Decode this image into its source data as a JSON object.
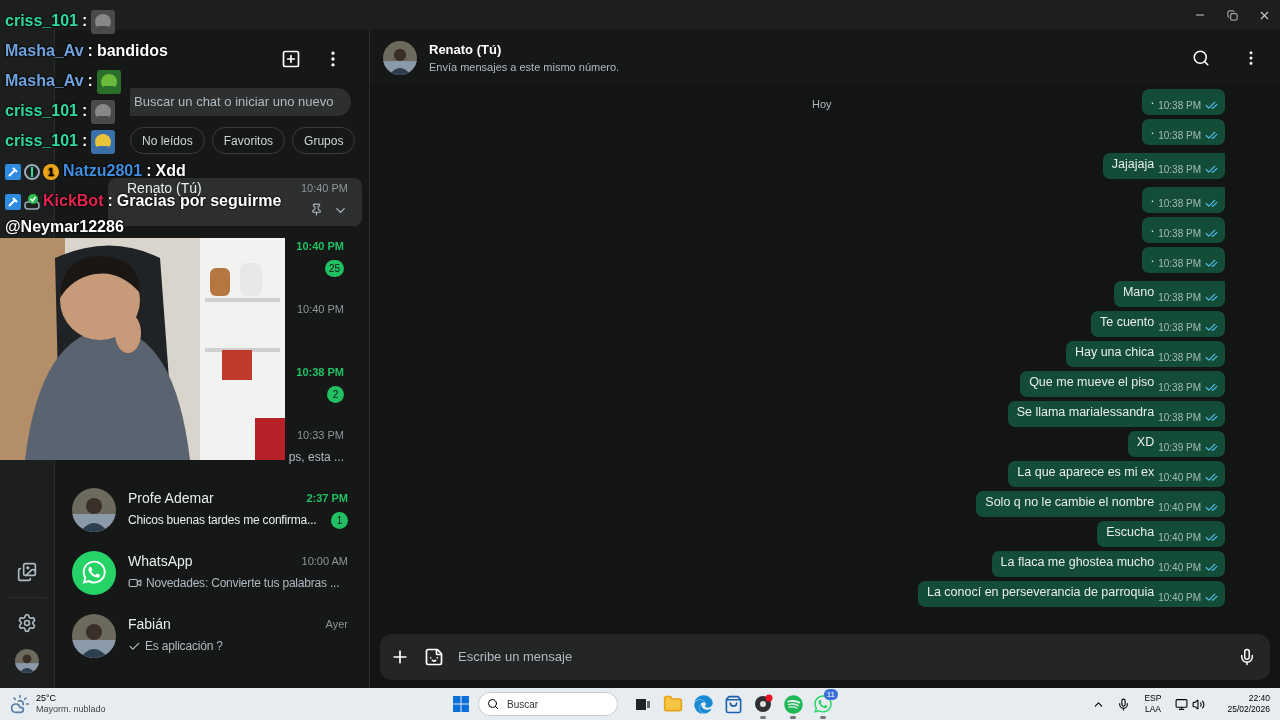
{
  "chat_list": {
    "search": {
      "placeholder": "Buscar un chat o iniciar uno nuevo"
    },
    "filters": [
      {
        "label": "No leídos",
        "selected": false
      },
      {
        "label": "Favoritos",
        "selected": false
      },
      {
        "label": "Grupos",
        "selected": false
      }
    ],
    "chats": [
      {
        "kind": "pinned-self",
        "name": "Renato (Tú)",
        "time": "10:40 PM",
        "pinned": true,
        "selected": true
      },
      {
        "kind": "covered",
        "time": "10:40 PM",
        "unread": "25",
        "selected": false
      },
      {
        "kind": "covered",
        "time": "10:40 PM",
        "selected": false
      },
      {
        "kind": "covered",
        "time": "10:38 PM",
        "unread": "2",
        "selected": false
      },
      {
        "kind": "covered",
        "time": "10:33 PM",
        "preview": "ps, esta ...",
        "selected": false
      },
      {
        "name": "Profe Ademar",
        "time": "2:37 PM",
        "preview": {
          "kind": "plain",
          "text": "Chicos buenas tardes me confirma..."
        },
        "unread": "1",
        "selected": false
      },
      {
        "kind": "official",
        "name": "WhatsApp",
        "time": "10:00 AM",
        "preview": {
          "kind": "video",
          "text": "Novedades: Convierte tus palabras ..."
        },
        "selected": false
      },
      {
        "name": "Fabián",
        "time": "Ayer",
        "preview": {
          "kind": "sent",
          "text": "Es aplicación ?"
        },
        "selected": false
      }
    ]
  },
  "stream_overlay": {
    "chat": [
      {
        "user": "criss_101",
        "color": "#2fd9a0",
        "separator": ":",
        "kind": "emote"
      },
      {
        "user": "Masha_Av",
        "color": "#6fa3e0",
        "separator": ":",
        "kind": "text",
        "message": "bandidos"
      },
      {
        "user": "Masha_Av",
        "color": "#6fa3e0",
        "separator": ":",
        "kind": "emote"
      },
      {
        "user": "criss_101",
        "color": "#2fd9a0",
        "separator": ":",
        "kind": "emote"
      },
      {
        "user": "criss_101",
        "color": "#2fd9a0",
        "separator": ":",
        "kind": "emote"
      },
      {
        "user": "Natzu2801",
        "color": "#3f8ee0",
        "separator": ":",
        "kind": "text",
        "message": "Xdd",
        "badges": [
          {
            "kind": "mod"
          },
          {
            "kind": "sub"
          },
          {
            "kind": "count",
            "text": "1"
          }
        ]
      },
      {
        "user": "KickBot",
        "color": "#e4234f",
        "separator": ":",
        "kind": "text",
        "message": "Gracias por seguirme",
        "continuation": "@Neymar12286",
        "badges": [
          {
            "kind": "mod"
          },
          {
            "kind": "bot"
          }
        ]
      }
    ]
  },
  "conversation": {
    "name": "Renato (Tú)",
    "subtitle": "Envía mensajes a este mismo número.",
    "date": "Hoy",
    "messages": [
      {
        "text": ".",
        "time": "10:38 PM",
        "read": true,
        "tail": false
      },
      {
        "text": ".",
        "time": "10:38 PM",
        "read": true,
        "tail": false
      },
      {
        "text": "Jajajaja",
        "time": "10:38 PM",
        "read": true,
        "tail": true
      },
      {
        "text": ".",
        "time": "10:38 PM",
        "read": true,
        "tail": true
      },
      {
        "text": ".",
        "time": "10:38 PM",
        "read": true,
        "tail": false
      },
      {
        "text": ".",
        "time": "10:38 PM",
        "read": true,
        "tail": false
      },
      {
        "text": "Mano",
        "time": "10:38 PM",
        "read": true,
        "tail": true
      },
      {
        "text": "Te cuento",
        "time": "10:38 PM",
        "read": true,
        "tail": false
      },
      {
        "text": "Hay una chica",
        "time": "10:38 PM",
        "read": true,
        "tail": false
      },
      {
        "text": "Que me mueve el piso",
        "time": "10:38 PM",
        "read": true,
        "tail": false
      },
      {
        "text": "Se llama marialessandra",
        "time": "10:38 PM",
        "read": true,
        "tail": false
      },
      {
        "text": "XD",
        "time": "10:39 PM",
        "read": true,
        "tail": false
      },
      {
        "text": "La que aparece es mi ex",
        "time": "10:40 PM",
        "read": true,
        "tail": false
      },
      {
        "text": "Solo q no le cambie el nombre",
        "time": "10:40 PM",
        "read": true,
        "tail": false
      },
      {
        "text": "Escucha",
        "time": "10:40 PM",
        "read": true,
        "tail": false
      },
      {
        "text": "La flaca me ghostea mucho",
        "time": "10:40 PM",
        "read": true,
        "tail": false
      },
      {
        "text": "La conocí en perseverancia de parroquia",
        "time": "10:40 PM",
        "read": true,
        "tail": false
      }
    ],
    "composer": {
      "placeholder": "Escribe un mensaje"
    }
  },
  "taskbar": {
    "weather": {
      "temp": "25°C",
      "condition": "Mayorm. nublado"
    },
    "search": {
      "placeholder": "Buscar"
    },
    "apps": [
      {
        "kind": "taskview",
        "running": false
      },
      {
        "kind": "explorer",
        "running": false
      },
      {
        "kind": "edge",
        "running": false
      },
      {
        "kind": "store",
        "running": false
      },
      {
        "kind": "obs",
        "running": true
      },
      {
        "kind": "spotify",
        "running": true
      },
      {
        "kind": "whatsapp",
        "running": true,
        "badge": "11"
      }
    ],
    "language": "ESP",
    "layout": "LAA",
    "time": "22:40",
    "date": "25/02/2026"
  }
}
